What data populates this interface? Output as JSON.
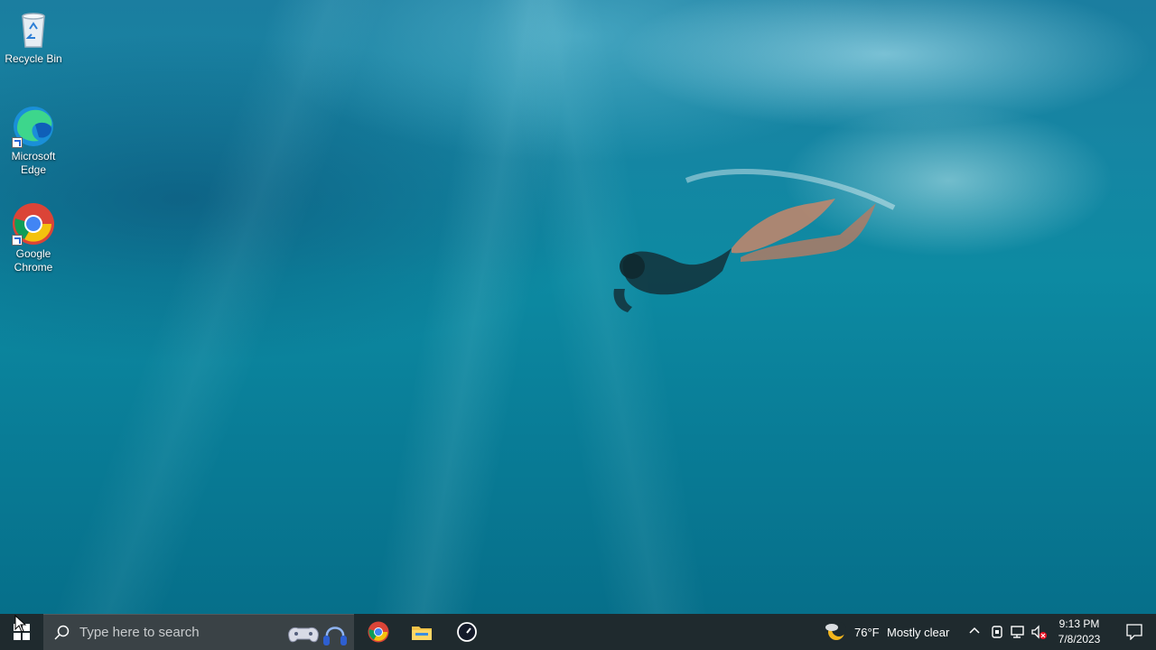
{
  "desktop": {
    "icons": [
      {
        "label": "Recycle Bin",
        "icon": "recycle-bin-icon"
      },
      {
        "label": "Microsoft Edge",
        "icon": "edge-icon"
      },
      {
        "label": "Google Chrome",
        "icon": "chrome-icon"
      }
    ]
  },
  "taskbar": {
    "search_placeholder": "Type here to search",
    "pinned": [
      {
        "name": "Google Chrome",
        "icon": "chrome-icon"
      },
      {
        "name": "File Explorer",
        "icon": "file-explorer-icon"
      },
      {
        "name": "Speed Test",
        "icon": "gauge-icon"
      }
    ],
    "weather": {
      "temp": "76°F",
      "condition": "Mostly clear",
      "icon": "moon-cloud-icon"
    },
    "clock": {
      "time": "9:13 PM",
      "date": "7/8/2023"
    }
  },
  "colors": {
    "taskbar": "#1f2a2e",
    "search_box": "#3a4246",
    "wallpaper_main": "#0d8aa2"
  }
}
